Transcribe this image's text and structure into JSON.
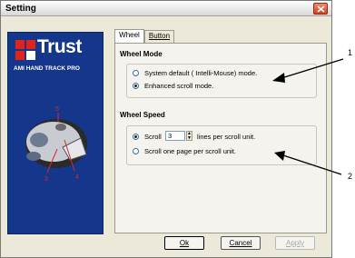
{
  "window": {
    "title": "Setting"
  },
  "logo": {
    "brand": "Trust",
    "subtitle": "AMI HAND TRACK PRO"
  },
  "mouse_labels": {
    "a": "5",
    "b": "4",
    "c": "3"
  },
  "tabs": [
    {
      "label": "Wheel",
      "selected": true
    },
    {
      "label": "Button",
      "selected": false
    }
  ],
  "wheel_mode": {
    "title": "Wheel Mode",
    "options": [
      {
        "label": "System default ( Intelli-Mouse) mode.",
        "checked": false
      },
      {
        "label": "Enhanced scroll mode.",
        "checked": true
      }
    ]
  },
  "wheel_speed": {
    "title": "Wheel Speed",
    "scroll_label": "Scroll",
    "scroll_value": "3",
    "scroll_suffix": "lines per scroll unit.",
    "page_label": "Scroll one page per scroll unit.",
    "scroll_checked": true,
    "page_checked": false
  },
  "buttons": {
    "ok": "Ok",
    "cancel": "Cancel",
    "apply": "Apply"
  },
  "callouts": {
    "one": "1",
    "two": "2"
  }
}
